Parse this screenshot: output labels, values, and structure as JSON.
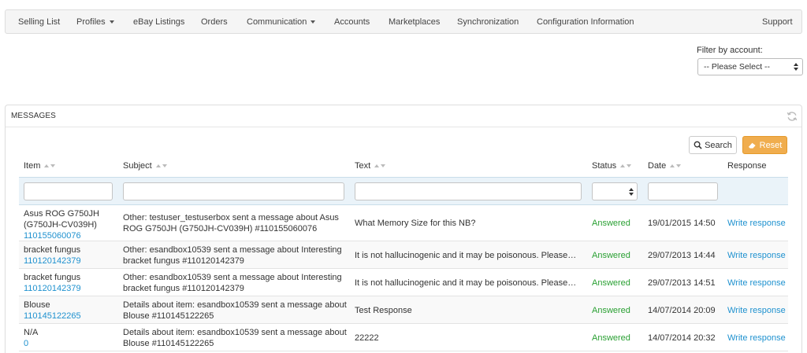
{
  "nav": {
    "selling_list": "Selling List",
    "profiles": "Profiles",
    "ebay_listings": "eBay Listings",
    "orders": "Orders",
    "communication": "Communication",
    "accounts": "Accounts",
    "marketplaces": "Marketplaces",
    "synchronization": "Synchronization",
    "configuration_information": "Configuration Information",
    "support": "Support"
  },
  "filter": {
    "label": "Filter by account:",
    "selected": "-- Please Select --"
  },
  "panel": {
    "title": "MESSAGES",
    "search_label": "Search",
    "reset_label": "Reset"
  },
  "columns": {
    "item": "Item",
    "subject": "Subject",
    "text": "Text",
    "status": "Status",
    "date": "Date",
    "response": "Response"
  },
  "rows": [
    {
      "item_name": "Asus ROG G750JH (G750JH-CV039H)",
      "item_id": "110155060076",
      "subject": "Other: testuser_testuserbox sent a message about Asus ROG G750JH (G750JH-CV039H) #110155060076",
      "text": "What Memory Size for this NB?",
      "status": "Answered",
      "date": "19/01/2015 14:50",
      "response": "Write response"
    },
    {
      "item_name": "bracket fungus",
      "item_id": "110120142379",
      "subject": "Other: esandbox10539 sent a message about Interesting bracket fungus #110120142379",
      "text": "It is not hallucinogenic and it may be poisonous. Please…",
      "status": "Answered",
      "date": "29/07/2013 14:44",
      "response": "Write response"
    },
    {
      "item_name": "bracket fungus",
      "item_id": "110120142379",
      "subject": "Other: esandbox10539 sent a message about Interesting bracket fungus #110120142379",
      "text": "It is not hallucinogenic and it may be poisonous. Please…",
      "status": "Answered",
      "date": "29/07/2013 14:51",
      "response": "Write response"
    },
    {
      "item_name": "Blouse",
      "item_id": "110145122265",
      "subject": "Details about item: esandbox10539 sent a message about Blouse #110145122265",
      "text": "Test Response",
      "status": "Answered",
      "date": "14/07/2014 20:09",
      "response": "Write response"
    },
    {
      "item_name": "N/A",
      "item_id": "0",
      "subject": "Details about item: esandbox10539 sent a message about Blouse #110145122265",
      "text": "22222",
      "status": "Answered",
      "date": "14/07/2014 20:32",
      "response": "Write response"
    }
  ],
  "colors": {
    "link": "#1e91cf",
    "answered": "#2aa033",
    "reset_button": "#f0ad4e",
    "filter_row": "#eaf3f9"
  }
}
